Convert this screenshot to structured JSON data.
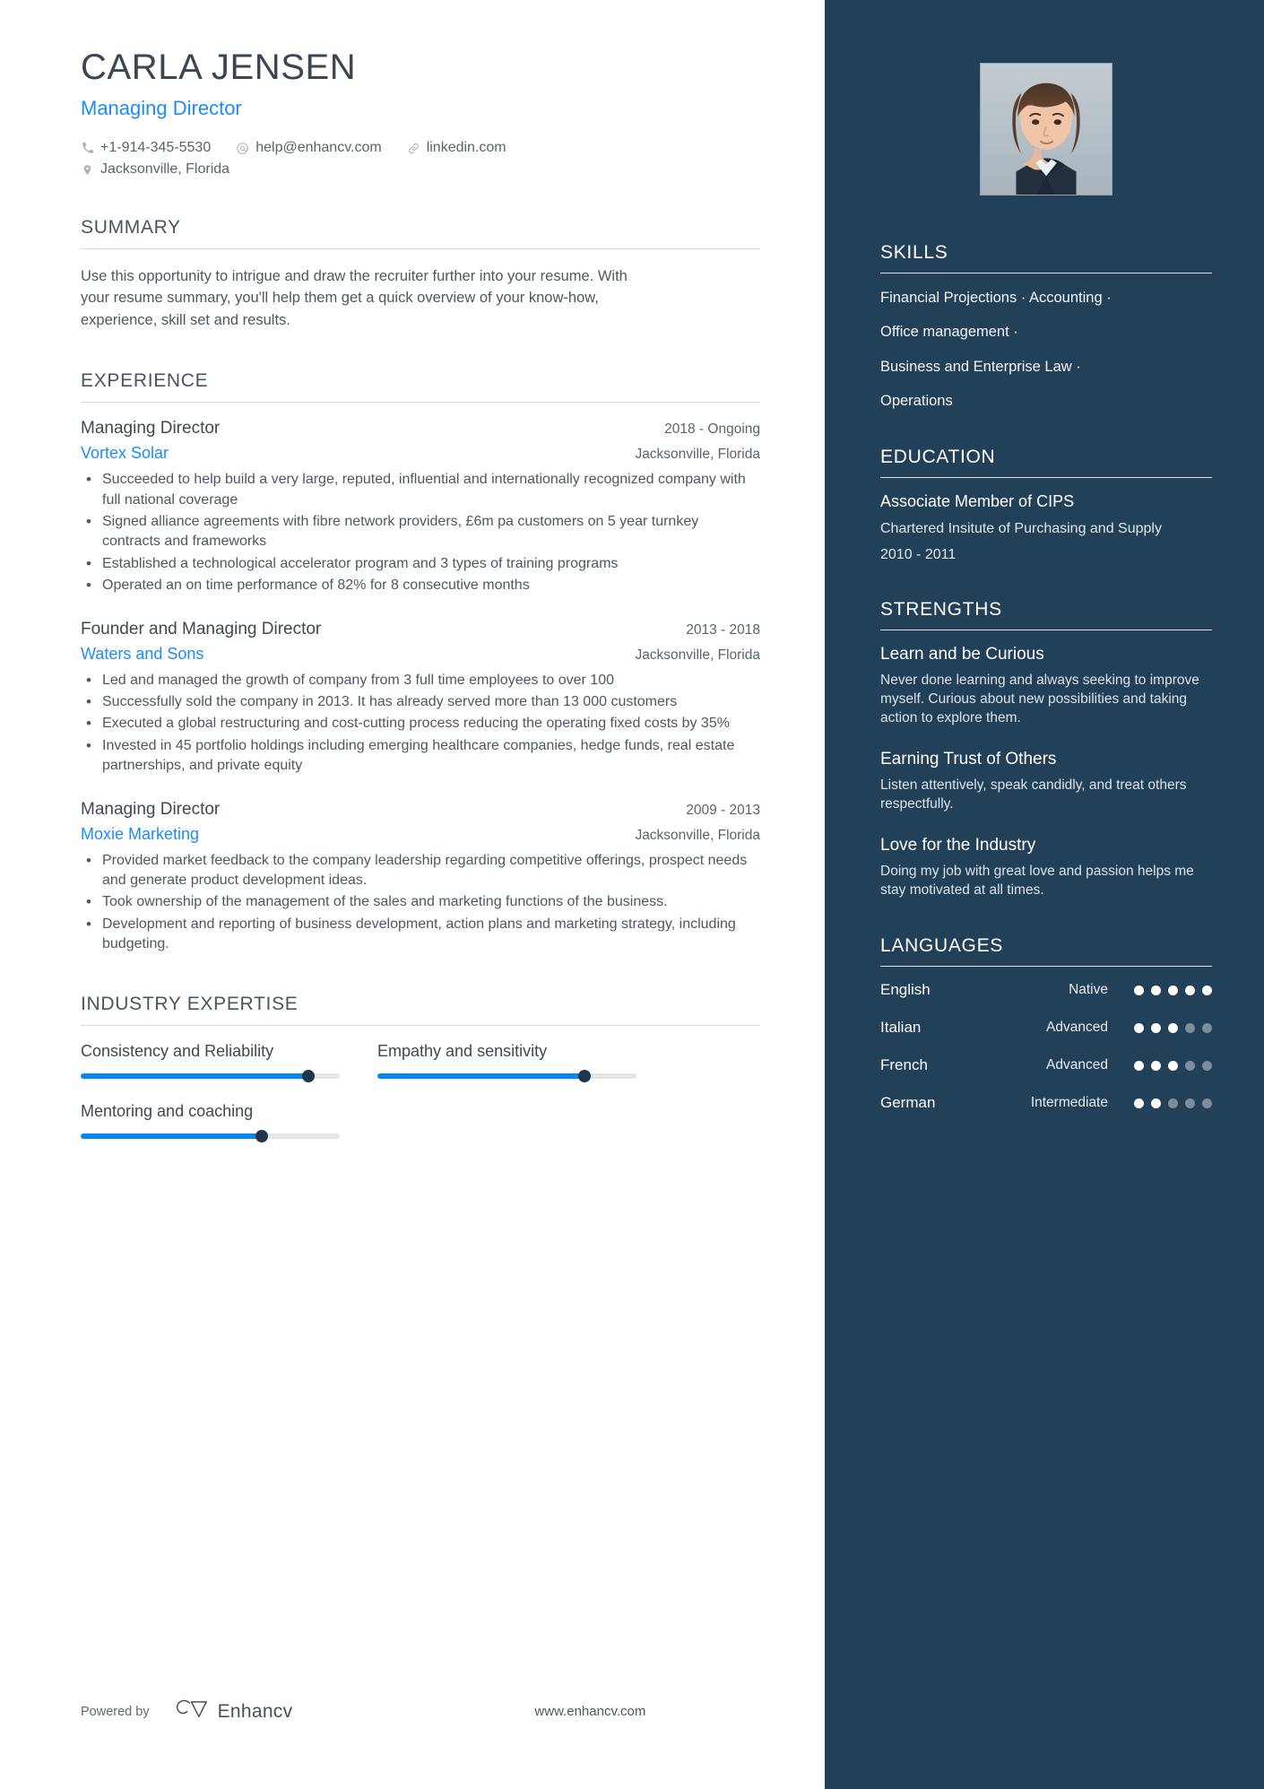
{
  "header": {
    "name": "CARLA JENSEN",
    "job_title": "Managing Director",
    "accent_color": "#1a8cff",
    "contacts": [
      {
        "icon": "phone-icon",
        "text": "+1-914-345-5530"
      },
      {
        "icon": "email-icon",
        "text": "help@enhancv.com"
      },
      {
        "icon": "link-icon",
        "text": "linkedin.com"
      }
    ],
    "location": {
      "icon": "location-icon",
      "text": "Jacksonville, Florida"
    }
  },
  "summary": {
    "title": "SUMMARY",
    "text": "Use this opportunity to intrigue and draw the recruiter further into your resume. With your resume summary, you'll help them get a quick overview of your know-how, experience, skill set and results."
  },
  "experience": {
    "title": "EXPERIENCE",
    "jobs": [
      {
        "position": "Managing Director",
        "dates": "2018 - Ongoing",
        "company": "Vortex Solar",
        "location": "Jacksonville, Florida",
        "bullets": [
          "Succeeded to help build a very large, reputed, influential and internationally recognized company with full national coverage",
          "Signed alliance agreements with fibre network providers, £6m pa customers on 5 year turnkey contracts and frameworks",
          "Established a technological accelerator program and 3 types of training programs",
          "Operated an on time performance of 82% for 8 consecutive months"
        ]
      },
      {
        "position": "Founder and Managing Director",
        "dates": "2013 - 2018",
        "company": "Waters and Sons",
        "location": "Jacksonville, Florida",
        "bullets": [
          "Led and managed the growth of company from 3 full time employees to over 100",
          "Successfully sold the company in 2013. It has already served more than 13 000 customers",
          "Executed a global restructuring and cost-cutting process reducing the operating fixed costs by 35%",
          "Invested in 45 portfolio holdings including emerging healthcare companies, hedge funds, real estate partnerships, and private equity"
        ]
      },
      {
        "position": "Managing Director",
        "dates": "2009 - 2013",
        "company": "Moxie Marketing",
        "location": "Jacksonville, Florida",
        "bullets": [
          "Provided market feedback to the company leadership regarding competitive offerings, prospect needs and generate product development ideas.",
          "Took ownership of the management of the sales and marketing functions of the business.",
          "Development and reporting of business development, action plans and marketing strategy, including budgeting."
        ]
      }
    ]
  },
  "industry_expertise": {
    "title": "INDUSTRY EXPERTISE",
    "items": [
      {
        "label": "Consistency and Reliability",
        "percent": 88
      },
      {
        "label": "Empathy and sensitivity",
        "percent": 80
      },
      {
        "label": "Mentoring and coaching",
        "percent": 70
      }
    ]
  },
  "footer": {
    "powered_by": "Powered by",
    "brand": "Enhancv",
    "website": "www.enhancv.com"
  },
  "sidebar": {
    "photo_alt": "profile-photo",
    "skills": {
      "title": "SKILLS",
      "lines": [
        "Financial Projections · Accounting ·",
        "Office management ·",
        "Business and Enterprise Law ·",
        "Operations"
      ]
    },
    "education": {
      "title": "EDUCATION",
      "degree": "Associate Member of CIPS",
      "school": "Chartered Insitute of Purchasing and Supply",
      "dates": "2010 - 2011"
    },
    "strengths": {
      "title": "STRENGTHS",
      "items": [
        {
          "title": "Learn and be Curious",
          "desc": "Never done learning and always seeking to improve myself. Curious about new possibilities and taking action to explore them."
        },
        {
          "title": "Earning Trust of Others",
          "desc": "Listen attentively, speak candidly, and treat others respectfully."
        },
        {
          "title": "Love for the Industry",
          "desc": "Doing my job with great love and passion helps me stay motivated at all times."
        }
      ]
    },
    "languages": {
      "title": "LANGUAGES",
      "items": [
        {
          "name": "English",
          "level": "Native",
          "dots": 5,
          "total": 5
        },
        {
          "name": "Italian",
          "level": "Advanced",
          "dots": 3,
          "total": 5
        },
        {
          "name": "French",
          "level": "Advanced",
          "dots": 3,
          "total": 5
        },
        {
          "name": "German",
          "level": "Intermediate",
          "dots": 2,
          "total": 5
        }
      ]
    }
  }
}
